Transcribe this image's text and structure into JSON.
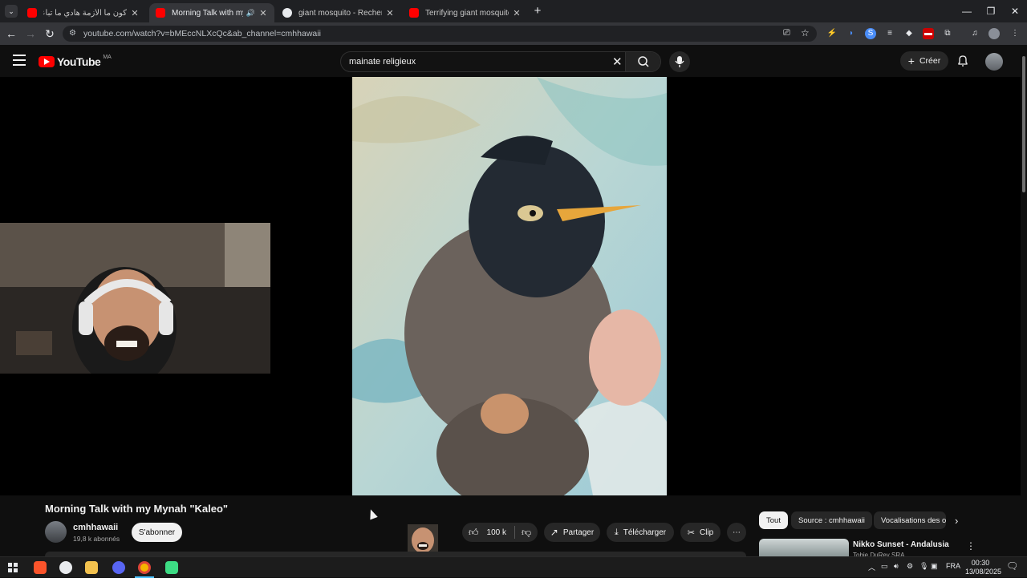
{
  "browser": {
    "tabs": [
      {
        "label": "كون ما الأزمة هادي ما تباعش بهاد",
        "favicon_color": "#ff0000"
      },
      {
        "label": "Morning Talk with my Mynah",
        "favicon_color": "#ff0000",
        "active": true
      },
      {
        "label": "giant mosquito - Recherche Goo",
        "favicon_color": "#e8eaed"
      },
      {
        "label": "Terrifying giant mosquito disco",
        "favicon_color": "#ff0000"
      }
    ],
    "url": "youtube.com/watch?v=bMEccNLXcQc&ab_channel=cmhhawaii"
  },
  "youtube": {
    "logo_text": "YouTube",
    "region": "MA",
    "search_value": "mainate religieux",
    "create_label": "Créer"
  },
  "video": {
    "title": "Morning Talk with my Mynah \"Kaleo\"",
    "channel_name": "cmhhawaii",
    "subscribers": "19,8 k abonnés",
    "subscribe_label": "S'abonner",
    "likes": "100 k",
    "share_label": "Partager",
    "download_label": "Télécharger",
    "clip_label": "Clip"
  },
  "chips": [
    "Tout",
    "Source : cmhhawaii",
    "Vocalisations des o"
  ],
  "recommendation": {
    "title": "Nikko Sunset - Andalusia",
    "channel": "Tobie DuRey SRA"
  },
  "taskbar": {
    "language": "FRA",
    "time": "00:30",
    "date": "13/08/2025"
  },
  "colors": {
    "youtube_red": "#ff0000",
    "chrome_bg": "#1f2023",
    "toolbar_bg": "#35363a",
    "page_bg": "#0f0f0f"
  }
}
